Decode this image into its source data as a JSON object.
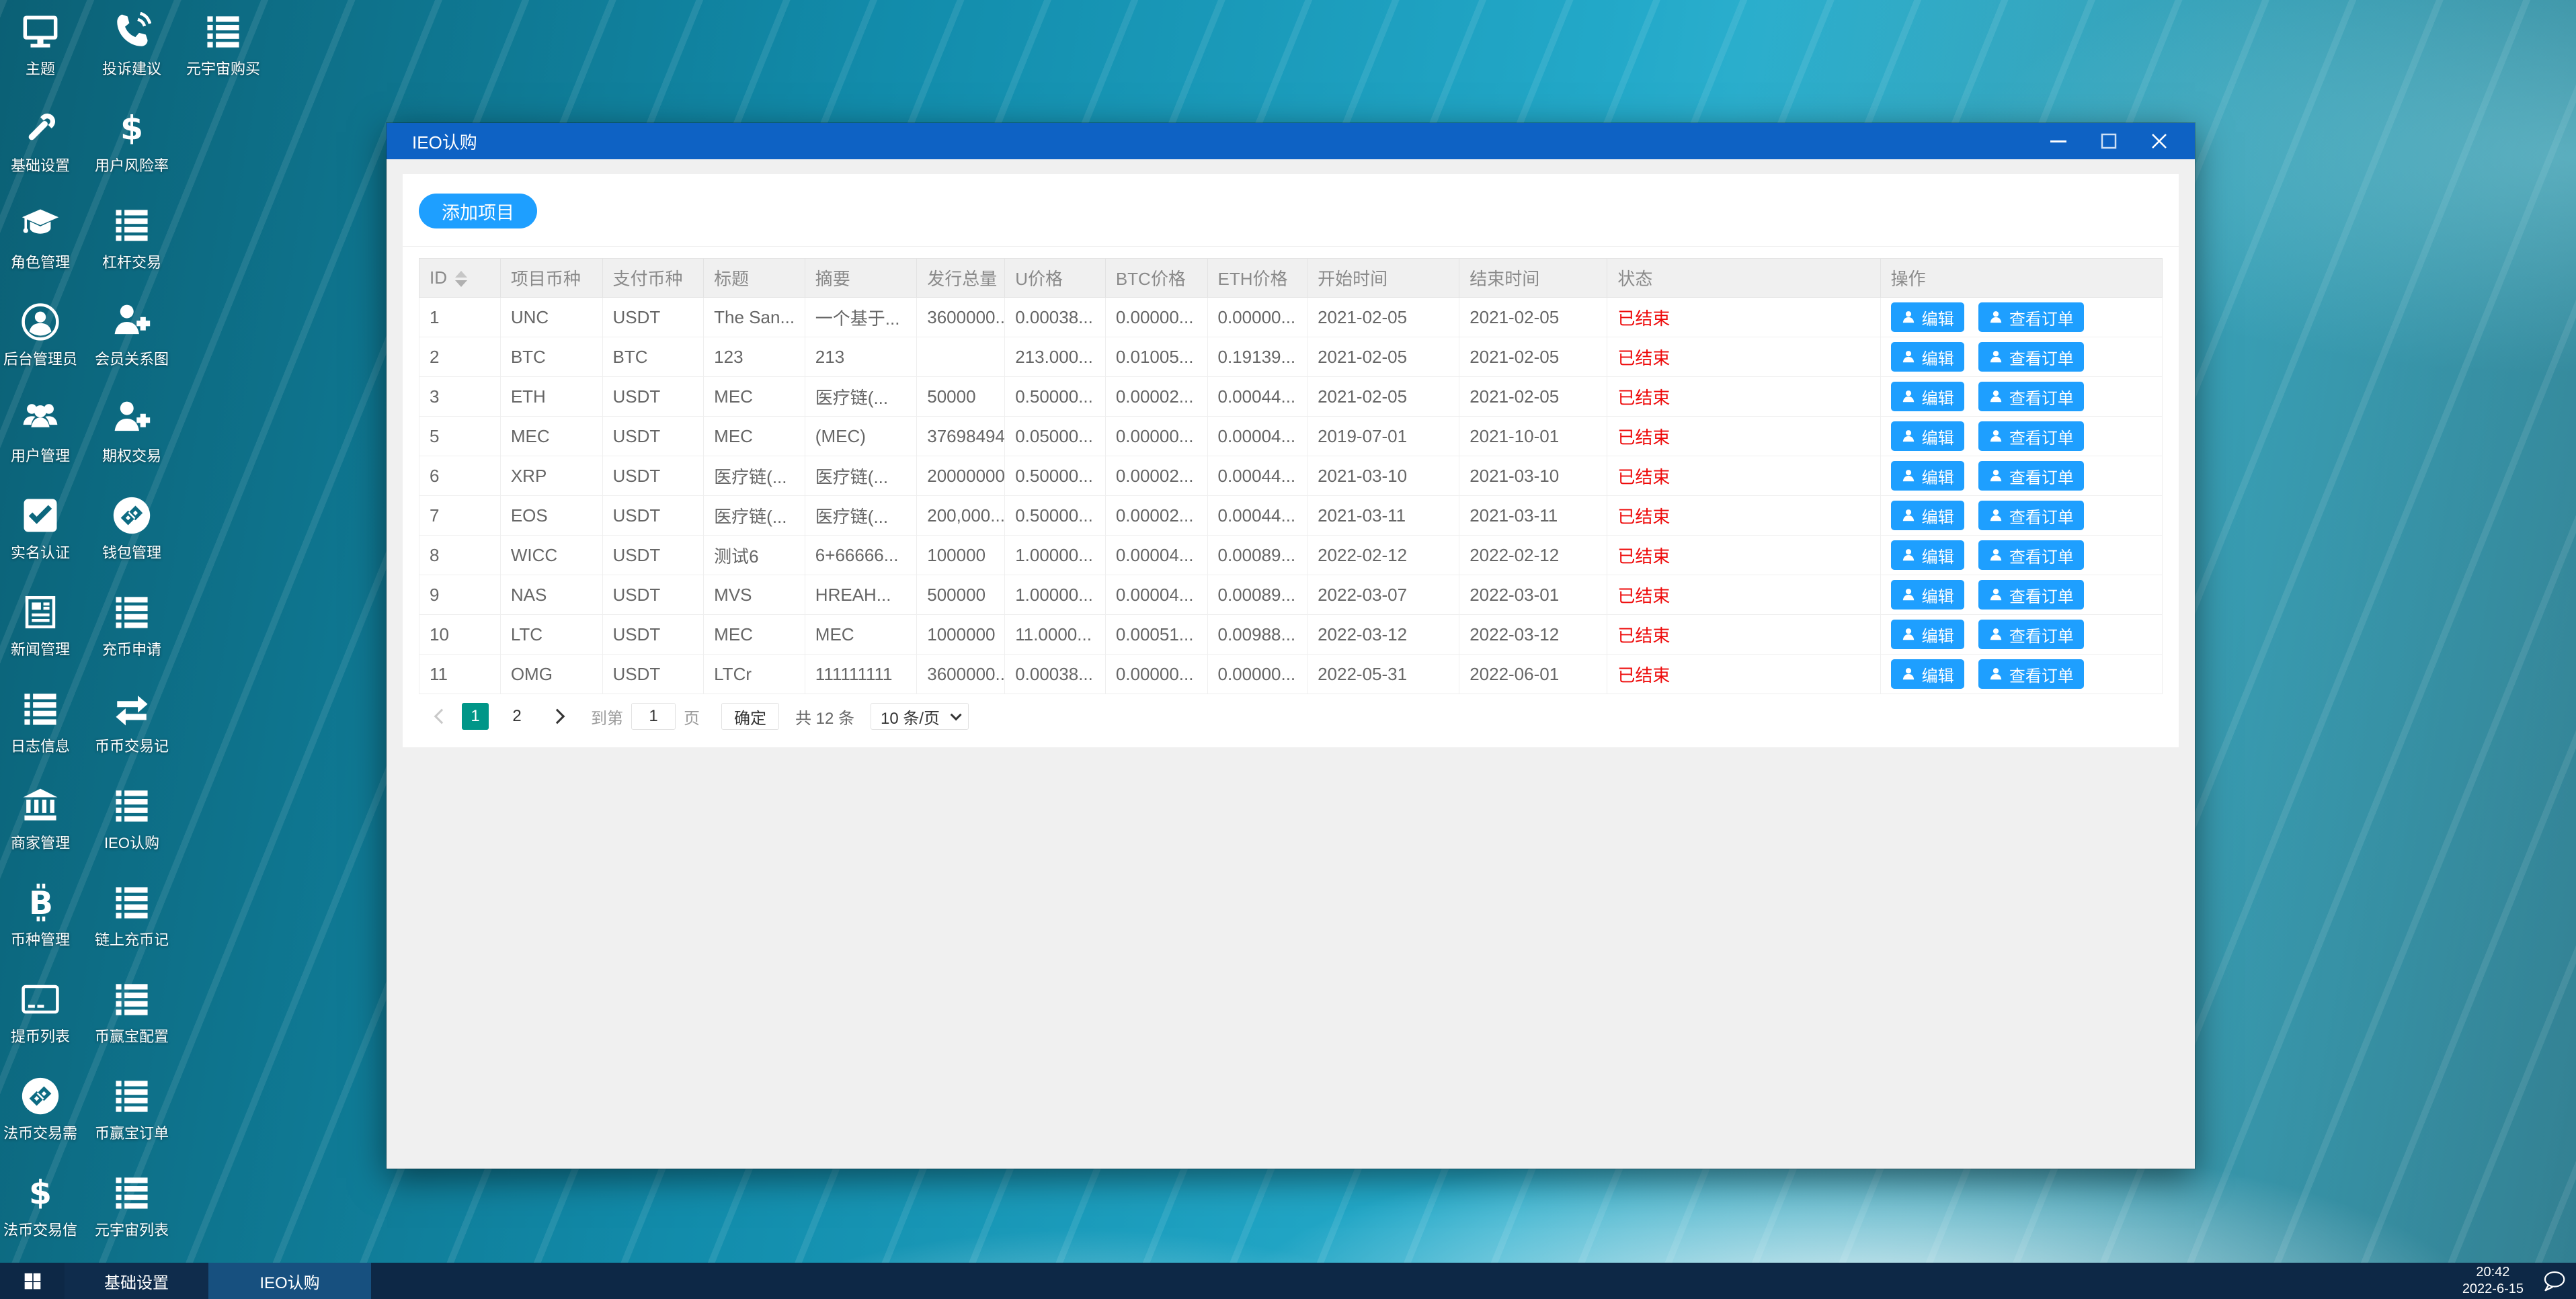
{
  "desktop": {
    "icons": [
      {
        "label": "主题",
        "icon": "monitor",
        "col": 0,
        "row": 0
      },
      {
        "label": "投诉建议",
        "icon": "phone",
        "col": 1,
        "row": 0
      },
      {
        "label": "元宇宙购买",
        "icon": "list",
        "col": 2,
        "row": 0
      },
      {
        "label": "基础设置",
        "icon": "wrench",
        "col": 0,
        "row": 1
      },
      {
        "label": "用户风险率",
        "icon": "dollar",
        "col": 1,
        "row": 1
      },
      {
        "label": "角色管理",
        "icon": "graduation-cap",
        "col": 0,
        "row": 2
      },
      {
        "label": "杠杆交易",
        "icon": "list",
        "col": 1,
        "row": 2
      },
      {
        "label": "后台管理员",
        "icon": "admin-user",
        "col": 0,
        "row": 3
      },
      {
        "label": "会员关系图",
        "icon": "user-plus",
        "col": 1,
        "row": 3
      },
      {
        "label": "用户管理",
        "icon": "users",
        "col": 0,
        "row": 4
      },
      {
        "label": "期权交易",
        "icon": "user-plus",
        "col": 1,
        "row": 4
      },
      {
        "label": "实名认证",
        "icon": "check-square",
        "col": 0,
        "row": 5
      },
      {
        "label": "钱包管理",
        "icon": "wallet-links",
        "col": 1,
        "row": 5
      },
      {
        "label": "新闻管理",
        "icon": "newspaper",
        "col": 0,
        "row": 6
      },
      {
        "label": "充币申请",
        "icon": "list",
        "col": 1,
        "row": 6
      },
      {
        "label": "日志信息",
        "icon": "list",
        "col": 0,
        "row": 7
      },
      {
        "label": "币币交易记",
        "icon": "exchange-arrows",
        "col": 1,
        "row": 7
      },
      {
        "label": "商家管理",
        "icon": "bank",
        "col": 0,
        "row": 8
      },
      {
        "label": "IEO认购",
        "icon": "list",
        "col": 1,
        "row": 8
      },
      {
        "label": "币种管理",
        "icon": "bitcoin",
        "col": 0,
        "row": 9
      },
      {
        "label": "链上充币记",
        "icon": "list",
        "col": 1,
        "row": 9
      },
      {
        "label": "提币列表",
        "icon": "credit-card",
        "col": 0,
        "row": 10
      },
      {
        "label": "币赢宝配置",
        "icon": "list",
        "col": 1,
        "row": 10
      },
      {
        "label": "法币交易需",
        "icon": "wallet-links",
        "col": 0,
        "row": 11
      },
      {
        "label": "币赢宝订单",
        "icon": "list",
        "col": 1,
        "row": 11
      },
      {
        "label": "法币交易信",
        "icon": "dollar",
        "col": 0,
        "row": 12
      },
      {
        "label": "元宇宙列表",
        "icon": "list",
        "col": 1,
        "row": 12
      }
    ]
  },
  "window": {
    "title": "IEO认购",
    "toolbar": {
      "add_label": "添加项目"
    },
    "table": {
      "columns": [
        "ID",
        "项目币种",
        "支付币种",
        "标题",
        "摘要",
        "发行总量",
        "U价格",
        "BTC价格",
        "ETH价格",
        "开始时间",
        "结束时间",
        "状态",
        "操作"
      ],
      "actions": {
        "edit": "编辑",
        "view": "查看订单"
      },
      "rows": [
        {
          "id": "1",
          "project": "UNC",
          "pay": "USDT",
          "title": "The San...",
          "summary": "一个基于...",
          "total": "3600000...",
          "u_price": "0.00038...",
          "btc_price": "0.00000...",
          "eth_price": "0.00000...",
          "start": "2021-02-05",
          "end": "2021-02-05",
          "status": "已结束"
        },
        {
          "id": "2",
          "project": "BTC",
          "pay": "BTC",
          "title": "123",
          "summary": "213",
          "total": "",
          "u_price": "213.000...",
          "btc_price": "0.01005...",
          "eth_price": "0.19139...",
          "start": "2021-02-05",
          "end": "2021-02-05",
          "status": "已结束"
        },
        {
          "id": "3",
          "project": "ETH",
          "pay": "USDT",
          "title": "MEC",
          "summary": "医疗链(...",
          "total": "50000",
          "u_price": "0.50000...",
          "btc_price": "0.00002...",
          "eth_price": "0.00044...",
          "start": "2021-02-05",
          "end": "2021-02-05",
          "status": "已结束"
        },
        {
          "id": "5",
          "project": "MEC",
          "pay": "USDT",
          "title": "MEC",
          "summary": "(MEC)",
          "total": "37698494",
          "u_price": "0.05000...",
          "btc_price": "0.00000...",
          "eth_price": "0.00004...",
          "start": "2019-07-01",
          "end": "2021-10-01",
          "status": "已结束"
        },
        {
          "id": "6",
          "project": "XRP",
          "pay": "USDT",
          "title": "医疗链(...",
          "summary": "医疗链(...",
          "total": "20000000",
          "u_price": "0.50000...",
          "btc_price": "0.00002...",
          "eth_price": "0.00044...",
          "start": "2021-03-10",
          "end": "2021-03-10",
          "status": "已结束"
        },
        {
          "id": "7",
          "project": "EOS",
          "pay": "USDT",
          "title": "医疗链(...",
          "summary": "医疗链(...",
          "total": "200,000....",
          "u_price": "0.50000...",
          "btc_price": "0.00002...",
          "eth_price": "0.00044...",
          "start": "2021-03-11",
          "end": "2021-03-11",
          "status": "已结束"
        },
        {
          "id": "8",
          "project": "WICC",
          "pay": "USDT",
          "title": "测试6",
          "summary": "6+66666...",
          "total": "100000",
          "u_price": "1.00000...",
          "btc_price": "0.00004...",
          "eth_price": "0.00089...",
          "start": "2022-02-12",
          "end": "2022-02-12",
          "status": "已结束"
        },
        {
          "id": "9",
          "project": "NAS",
          "pay": "USDT",
          "title": "MVS",
          "summary": "HREAH...",
          "total": "500000",
          "u_price": "1.00000...",
          "btc_price": "0.00004...",
          "eth_price": "0.00089...",
          "start": "2022-03-07",
          "end": "2022-03-01",
          "status": "已结束"
        },
        {
          "id": "10",
          "project": "LTC",
          "pay": "USDT",
          "title": "MEC",
          "summary": "MEC",
          "total": "1000000",
          "u_price": "11.0000...",
          "btc_price": "0.00051...",
          "eth_price": "0.00988...",
          "start": "2022-03-12",
          "end": "2022-03-12",
          "status": "已结束"
        },
        {
          "id": "11",
          "project": "OMG",
          "pay": "USDT",
          "title": "LTCr",
          "summary": "111111111",
          "total": "3600000...",
          "u_price": "0.00038...",
          "btc_price": "0.00000...",
          "eth_price": "0.00000...",
          "start": "2022-05-31",
          "end": "2022-06-01",
          "status": "已结束"
        }
      ]
    },
    "pagination": {
      "pages": [
        {
          "label": "1",
          "active": true
        },
        {
          "label": "2",
          "active": false
        }
      ],
      "goto_label": "到第",
      "goto_value": "1",
      "page_unit": "页",
      "confirm_label": "确定",
      "total_text": "共 12 条",
      "per_page": "10 条/页"
    }
  },
  "taskbar": {
    "items": [
      {
        "label": "基础设置",
        "active": false
      },
      {
        "label": "IEO认购",
        "active": true
      }
    ],
    "clock": {
      "time": "20:42",
      "date": "2022-6-15"
    }
  },
  "colors": {
    "titlebar_blue": "#0e62c4",
    "button_blue": "#1e9fff",
    "pagination_active_green": "#009688",
    "status_red": "#ee0a0a",
    "taskbar_bg": "#0d2846",
    "taskbar_active_bg": "#17507f",
    "table_header_bg": "#f0f0f0"
  }
}
